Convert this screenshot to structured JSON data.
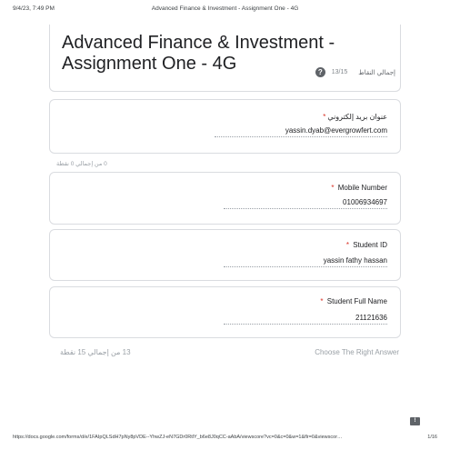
{
  "print_header": {
    "datetime": "9/4/23, 7:49 PM",
    "title": "Advanced Finance & Investment - Assignment One - 4G"
  },
  "form": {
    "title": "Advanced Finance & Investment - Assignment One - 4G",
    "total_points_label": "إجمالي النقاط",
    "score": "13/15"
  },
  "questions": [
    {
      "label": "عنوان بريد إلكتروني",
      "value": "yassin.dyab@evergrowfert.com"
    },
    {
      "label": "Mobile Number",
      "value": "01006934697"
    },
    {
      "label": "Student ID",
      "value": "yassin fathy hassan"
    },
    {
      "label": "Student Full Name",
      "value": "21121636"
    }
  ],
  "points_note_1": "0 من إجمالي 0 نقطة",
  "section": {
    "title": "Choose The Right Answer",
    "points": "13 من إجمالي 15 نقطة"
  },
  "print_footer": {
    "url": "https://docs.google.com/forms/d/e/1FAIpQLSdH7pNy8pVDE--YhwZJ-eN7GDr0RtlY_b6e8J0qCC-aAbA/viewscore?vc=0&c=0&w=1&flr=0&viewscor…",
    "page": "1/16"
  },
  "colors": {
    "required": "#d93025",
    "border": "#dadce0",
    "muted": "#9aa0a6"
  }
}
